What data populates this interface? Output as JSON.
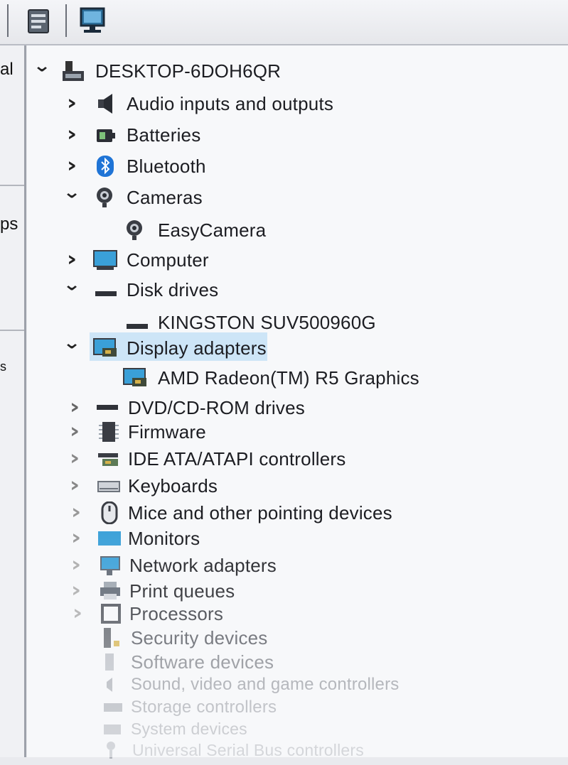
{
  "toolbar": {
    "buttons": [
      {
        "icon": "properties-icon"
      },
      {
        "icon": "computer-scan-icon"
      },
      {
        "icon": "monitor-icon"
      }
    ]
  },
  "left_pane": {
    "labels": [
      "al",
      "ps",
      "s"
    ]
  },
  "tree": {
    "root": {
      "label": "DESKTOP-6DOH6QR",
      "icon": "computer-root-icon",
      "expanded": true
    },
    "items": [
      {
        "label": "Audio inputs and outputs",
        "icon": "speaker-icon",
        "expanded": false
      },
      {
        "label": "Batteries",
        "icon": "battery-icon",
        "expanded": false
      },
      {
        "label": "Bluetooth",
        "icon": "bluetooth-icon",
        "expanded": false
      },
      {
        "label": "Cameras",
        "icon": "camera-icon",
        "expanded": true
      },
      {
        "label": "EasyCamera",
        "icon": "camera-icon",
        "child": true
      },
      {
        "label": "Computer",
        "icon": "computer-icon",
        "expanded": false
      },
      {
        "label": "Disk drives",
        "icon": "disk-drive-icon",
        "expanded": true
      },
      {
        "label": "KINGSTON SUV500960G",
        "icon": "disk-drive-icon",
        "child": true
      },
      {
        "label": "Display adapters",
        "icon": "display-adapter-icon",
        "expanded": true,
        "selected": true
      },
      {
        "label": "AMD Radeon(TM) R5 Graphics",
        "icon": "display-adapter-icon",
        "child": true
      },
      {
        "label": "DVD/CD-ROM drives",
        "icon": "dvd-drive-icon",
        "expanded": false
      },
      {
        "label": "Firmware",
        "icon": "firmware-icon",
        "expanded": false
      },
      {
        "label": "IDE ATA/ATAPI controllers",
        "icon": "ide-controller-icon",
        "expanded": false
      },
      {
        "label": "Keyboards",
        "icon": "keyboard-icon",
        "expanded": false
      },
      {
        "label": "Mice and other pointing devices",
        "icon": "mouse-icon",
        "expanded": false
      },
      {
        "label": "Monitors",
        "icon": "monitor-icon",
        "expanded": false
      },
      {
        "label": "Network adapters",
        "icon": "network-adapter-icon",
        "expanded": false
      },
      {
        "label": "Print queues",
        "icon": "printer-icon",
        "expanded": false
      },
      {
        "label": "Processors",
        "icon": "processor-icon",
        "expanded": false
      },
      {
        "label": "Security devices",
        "icon": "security-device-icon",
        "expanded": false
      },
      {
        "label": "Software devices",
        "icon": "software-device-icon",
        "expanded": false
      },
      {
        "label": "Sound, video and game controllers",
        "icon": "sound-controller-icon",
        "expanded": false
      },
      {
        "label": "Storage controllers",
        "icon": "storage-controller-icon",
        "expanded": false
      },
      {
        "label": "System devices",
        "icon": "system-device-icon",
        "expanded": false
      },
      {
        "label": "Universal Serial Bus controllers",
        "icon": "usb-controller-icon",
        "expanded": false
      }
    ]
  },
  "colors": {
    "selection": "#cde5f7",
    "text": "#1c1d22",
    "bluetooth": "#1f74d6",
    "monitor": "#3aa0d8"
  }
}
